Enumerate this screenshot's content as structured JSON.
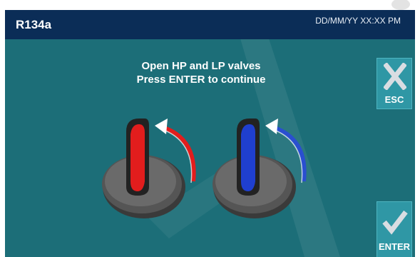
{
  "header": {
    "title": "R134a",
    "datetime": "DD/MM/YY XX:XX PM"
  },
  "main": {
    "instruction_line1": "Open HP and LP valves",
    "instruction_line2": "Press ENTER to continue"
  },
  "buttons": {
    "esc_label": "ESC",
    "enter_label": "ENTER"
  },
  "valves": [
    {
      "name": "HP",
      "color": "#e21d1d",
      "arrow_color": "#e21d1d"
    },
    {
      "name": "LP",
      "color": "#1f3fcf",
      "arrow_color": "#2a4fd0"
    }
  ],
  "colors": {
    "screen_bg": "#1c6e78",
    "header_bg": "#0b2d57",
    "button_bg": "#2f97a5"
  }
}
